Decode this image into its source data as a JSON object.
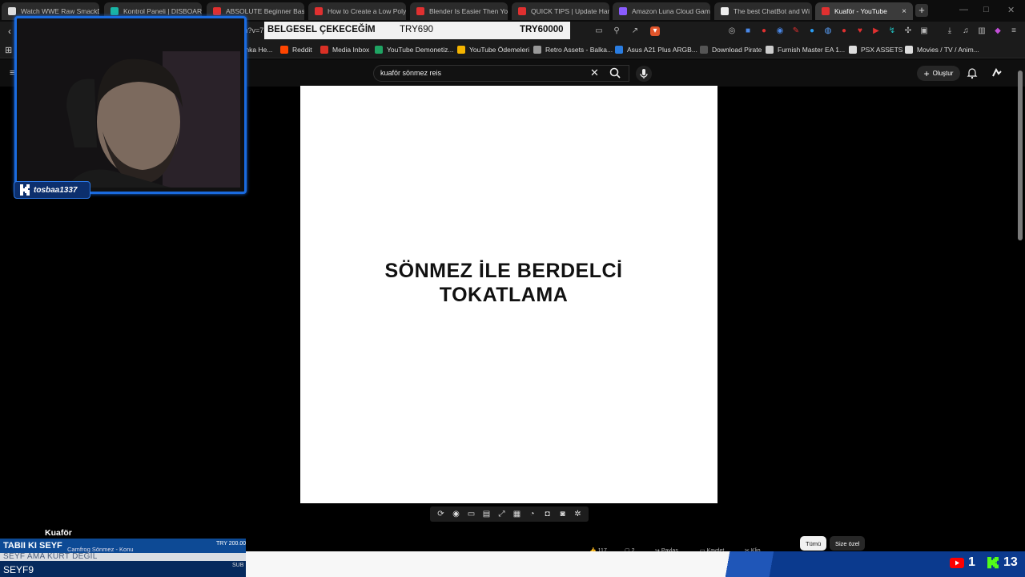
{
  "tabs": [
    {
      "title": "Watch WWE Raw SmackD",
      "fav": "#ddd"
    },
    {
      "title": "Kontrol Paneli | DISBOARD",
      "fav": "#19b5a6"
    },
    {
      "title": "ABSOLUTE Beginner Basic",
      "fav": "#e03030"
    },
    {
      "title": "How to Create a Low Poly",
      "fav": "#e03030"
    },
    {
      "title": "Blender Is Easier Then You",
      "fav": "#e03030"
    },
    {
      "title": "QUICK TIPS | Update Hand",
      "fav": "#e03030"
    },
    {
      "title": "Amazon Luna Cloud Gam",
      "fav": "#8a5cff"
    },
    {
      "title": "The best ChatBot and Wi",
      "fav": "#eee"
    },
    {
      "title": "Kuaför - YouTube",
      "fav": "#e03030"
    }
  ],
  "tab_close": "×",
  "new_tab": "+",
  "url_fragment": "ch?v=7",
  "donation_banner": {
    "text": "BELGESEL ÇEKECEĞİM",
    "amount1": "TRY690",
    "amount2": "TRY60000"
  },
  "bookmarks": [
    {
      "label": "Banka He...",
      "color": "#888"
    },
    {
      "label": "Reddit",
      "color": "#ff4500"
    },
    {
      "label": "Media Inbox",
      "color": "#d93025"
    },
    {
      "label": "YouTube Demonetiz...",
      "color": "#1fa463"
    },
    {
      "label": "YouTube Ödemeleri",
      "color": "#f4b400"
    },
    {
      "label": "Retro Assets - Balka...",
      "color": "#999"
    },
    {
      "label": "Asus A21 Plus ARGB...",
      "color": "#2a7de1"
    },
    {
      "label": "Download Pirate",
      "color": "#555"
    },
    {
      "label": "Furnish Master EA 1...",
      "color": "#ccc"
    },
    {
      "label": "PSX ASSETS",
      "color": "#ddd"
    },
    {
      "label": "Movies / TV / Anim...",
      "color": "#ddd"
    }
  ],
  "search": {
    "value": "kuaför sönmez reis"
  },
  "create_label": "Oluştur",
  "video": {
    "overlay_line1": "SÖNMEZ İLE BERDELCİ",
    "overlay_line2": "TOKATLAMA"
  },
  "channel_name": "Kuaför",
  "actions": {
    "likes": "117",
    "comments": "2",
    "share": "Paylaş",
    "save": "Kaydet",
    "clip": "Klip"
  },
  "chips": {
    "all": "Tümü",
    "for_you": "Size özel"
  },
  "ticker": {
    "line1": "TABII KI SEYF",
    "line1_sub": "Camfrog Sönmez - Konu",
    "line1_amount": "TRY 200.00",
    "line2": "SEYF AMA KURT DEĞİL",
    "line3": "SEYF9",
    "line3_tag": "SUB"
  },
  "counts": {
    "youtube": "1",
    "kick": "13"
  },
  "cam_name": "tosbaa1337",
  "colors": {
    "accent": "#1a6be0",
    "kick_green": "#53fc18",
    "yt_red": "#ff0000"
  }
}
